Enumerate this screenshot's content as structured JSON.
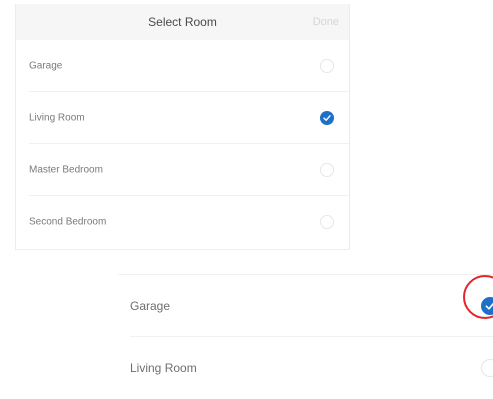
{
  "top_panel": {
    "title": "Select Room",
    "done_label": "Done",
    "rooms": [
      {
        "label": "Garage",
        "selected": false
      },
      {
        "label": "Living Room",
        "selected": true
      },
      {
        "label": "Master Bedroom",
        "selected": false
      },
      {
        "label": "Second Bedroom",
        "selected": false
      }
    ]
  },
  "bottom_panel": {
    "rooms": [
      {
        "label": "Garage",
        "selected": true
      },
      {
        "label": "Living Room",
        "selected": false
      }
    ]
  },
  "colors": {
    "accent": "#1e6fc7",
    "highlight": "#e3262a"
  },
  "icons": {
    "selected": "checkmark-icon",
    "unselected": "empty-radio-icon"
  }
}
